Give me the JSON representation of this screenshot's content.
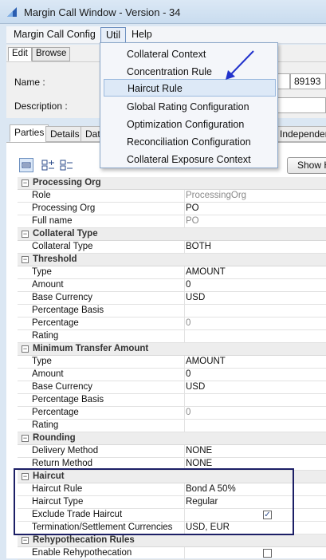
{
  "window": {
    "title": "Margin Call Window - Version - 34"
  },
  "menubar": {
    "items": [
      "Margin Call Config",
      "Util",
      "Help"
    ]
  },
  "edit_tabs": [
    "Edit",
    "Browse"
  ],
  "form": {
    "name_label": "Name :",
    "id_value": "89193",
    "description_label": "Description :"
  },
  "tabs": [
    "Parties",
    "Details",
    "Date",
    "Independent"
  ],
  "toolbar": {
    "show_button": "Show H"
  },
  "util_menu": {
    "items": [
      "Collateral Context",
      "Concentration Rule",
      "Haircut Rule",
      "Global Rating Configuration",
      "Optimization Configuration",
      "Reconciliation Configuration",
      "Collateral Exposure Context"
    ],
    "highlighted": "Haircut Rule"
  },
  "grid": {
    "sections": [
      {
        "title": "Processing Org",
        "rows": [
          {
            "label": "Role",
            "value": "ProcessingOrg",
            "gray": true
          },
          {
            "label": "Processing Org",
            "value": "PO"
          },
          {
            "label": "Full name",
            "value": "PO",
            "gray": true
          }
        ]
      },
      {
        "title": "Collateral Type",
        "rows": [
          {
            "label": "Collateral Type",
            "value": "BOTH"
          }
        ]
      },
      {
        "title": "Threshold",
        "rows": [
          {
            "label": "Type",
            "value": "AMOUNT"
          },
          {
            "label": "Amount",
            "value": "0"
          },
          {
            "label": "Base Currency",
            "value": "USD"
          },
          {
            "label": "Percentage Basis",
            "value": ""
          },
          {
            "label": "Percentage",
            "value": "0",
            "gray": true
          },
          {
            "label": "Rating",
            "value": ""
          }
        ]
      },
      {
        "title": "Minimum Transfer Amount",
        "rows": [
          {
            "label": "Type",
            "value": "AMOUNT"
          },
          {
            "label": "Amount",
            "value": "0"
          },
          {
            "label": "Base Currency",
            "value": "USD"
          },
          {
            "label": "Percentage Basis",
            "value": ""
          },
          {
            "label": "Percentage",
            "value": "0",
            "gray": true
          },
          {
            "label": "Rating",
            "value": ""
          }
        ]
      },
      {
        "title": "Rounding",
        "rows": [
          {
            "label": "Delivery Method",
            "value": "NONE"
          },
          {
            "label": "Return Method",
            "value": "NONE"
          }
        ]
      },
      {
        "title": "Haircut",
        "rows": [
          {
            "label": "Haircut Rule",
            "value": "Bond A 50%"
          },
          {
            "label": "Haircut Type",
            "value": "Regular"
          },
          {
            "label": "Exclude Trade Haircut",
            "value": "",
            "checkbox": true,
            "checked": true
          },
          {
            "label": "Termination/Settlement Currencies",
            "value": "USD, EUR"
          }
        ]
      },
      {
        "title": "Rehypothecation Rules",
        "rows": [
          {
            "label": "Enable Rehypothecation",
            "value": "",
            "checkbox": true,
            "checked": false
          }
        ]
      }
    ]
  },
  "colors": {
    "annotation": "#1c1f66",
    "highlight": "#dde9f7",
    "arrow": "#2233cc"
  }
}
